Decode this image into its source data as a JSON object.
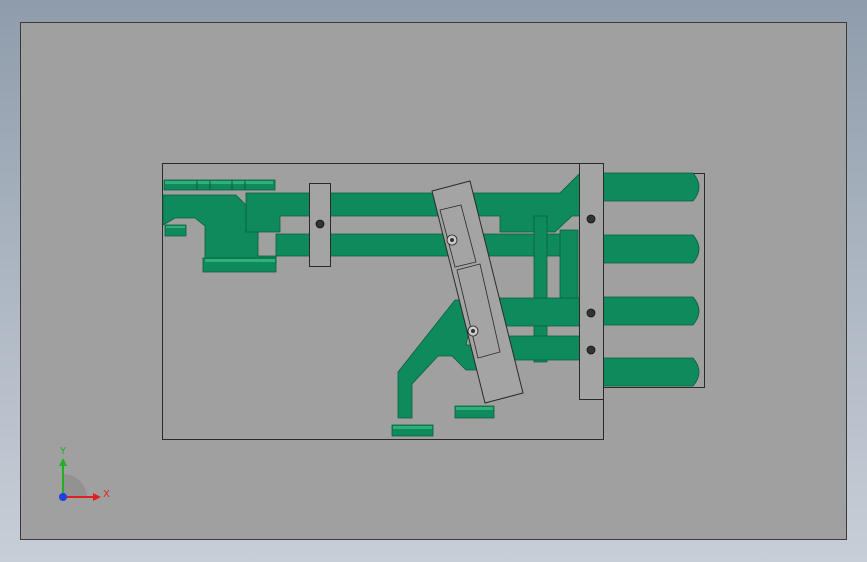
{
  "triad": {
    "y_label": "Y",
    "x_label": "X"
  },
  "colors": {
    "background_top": "#8f9cab",
    "background_bottom": "#c7ced7",
    "sheet": "#a0a0a0",
    "sheet_border": "#3a3a3a",
    "part_green": "#0e8a5c",
    "part_green_light": "#2fb07a",
    "part_green_dark": "#0a5e3e",
    "plate_gray": "#a4a4a4",
    "bolt": "#333333",
    "axis_x": "#e02020",
    "axis_y": "#20b020",
    "axis_z": "#2040e0"
  }
}
